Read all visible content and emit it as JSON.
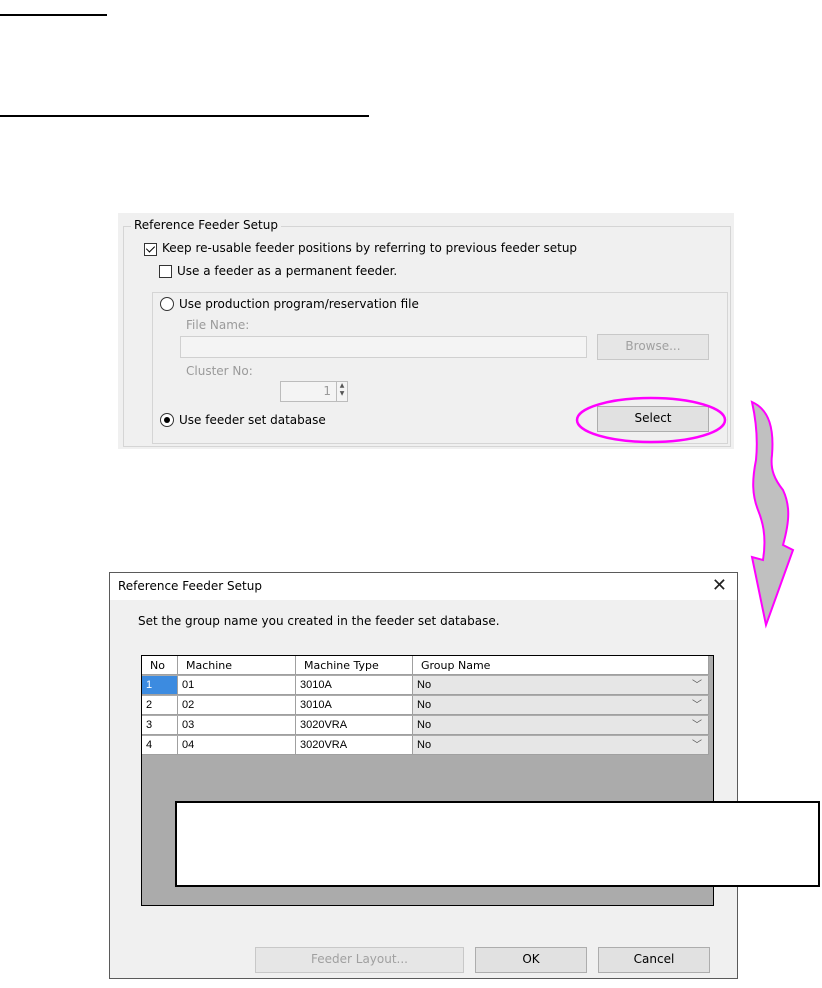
{
  "top_panel": {
    "group_title": "Reference Feeder Setup",
    "keep_positions_label": "Keep re-usable feeder positions by referring to previous feeder setup",
    "permanent_feeder_label": "Use a feeder as a permanent feeder.",
    "use_program_label": "Use production program/reservation file",
    "file_name_label": "File Name:",
    "file_name_value": "",
    "browse_label": "Browse...",
    "cluster_no_label": "Cluster No:",
    "cluster_no_value": "1",
    "use_db_label": "Use feeder set database",
    "select_label": "Select"
  },
  "dialog": {
    "title": "Reference Feeder Setup",
    "close_glyph": "✕",
    "instruction": "Set the group name you created in the feeder set database.",
    "columns": [
      "No",
      "Machine",
      "Machine Type",
      "Group Name"
    ],
    "rows": [
      {
        "no": "1",
        "machine": "01",
        "type": "3010A",
        "group": "No"
      },
      {
        "no": "2",
        "machine": "02",
        "type": "3010A",
        "group": "No"
      },
      {
        "no": "3",
        "machine": "03",
        "type": "3020VRA",
        "group": "No"
      },
      {
        "no": "4",
        "machine": "04",
        "type": "3020VRA",
        "group": "No"
      }
    ],
    "feeder_layout_label": "Feeder Layout...",
    "ok_label": "OK",
    "cancel_label": "Cancel"
  },
  "colors": {
    "highlight_ellipse": "#ff00ff",
    "flow_arrow_fill": "#c0c0c0",
    "grid_background": "#ababab"
  },
  "icons": [
    "checkbox-checked",
    "checkbox-unchecked",
    "radio-unselected",
    "radio-selected",
    "spin-arrows-icon",
    "chevron-down-icon",
    "close-icon",
    "curved-arrow-icon"
  ]
}
